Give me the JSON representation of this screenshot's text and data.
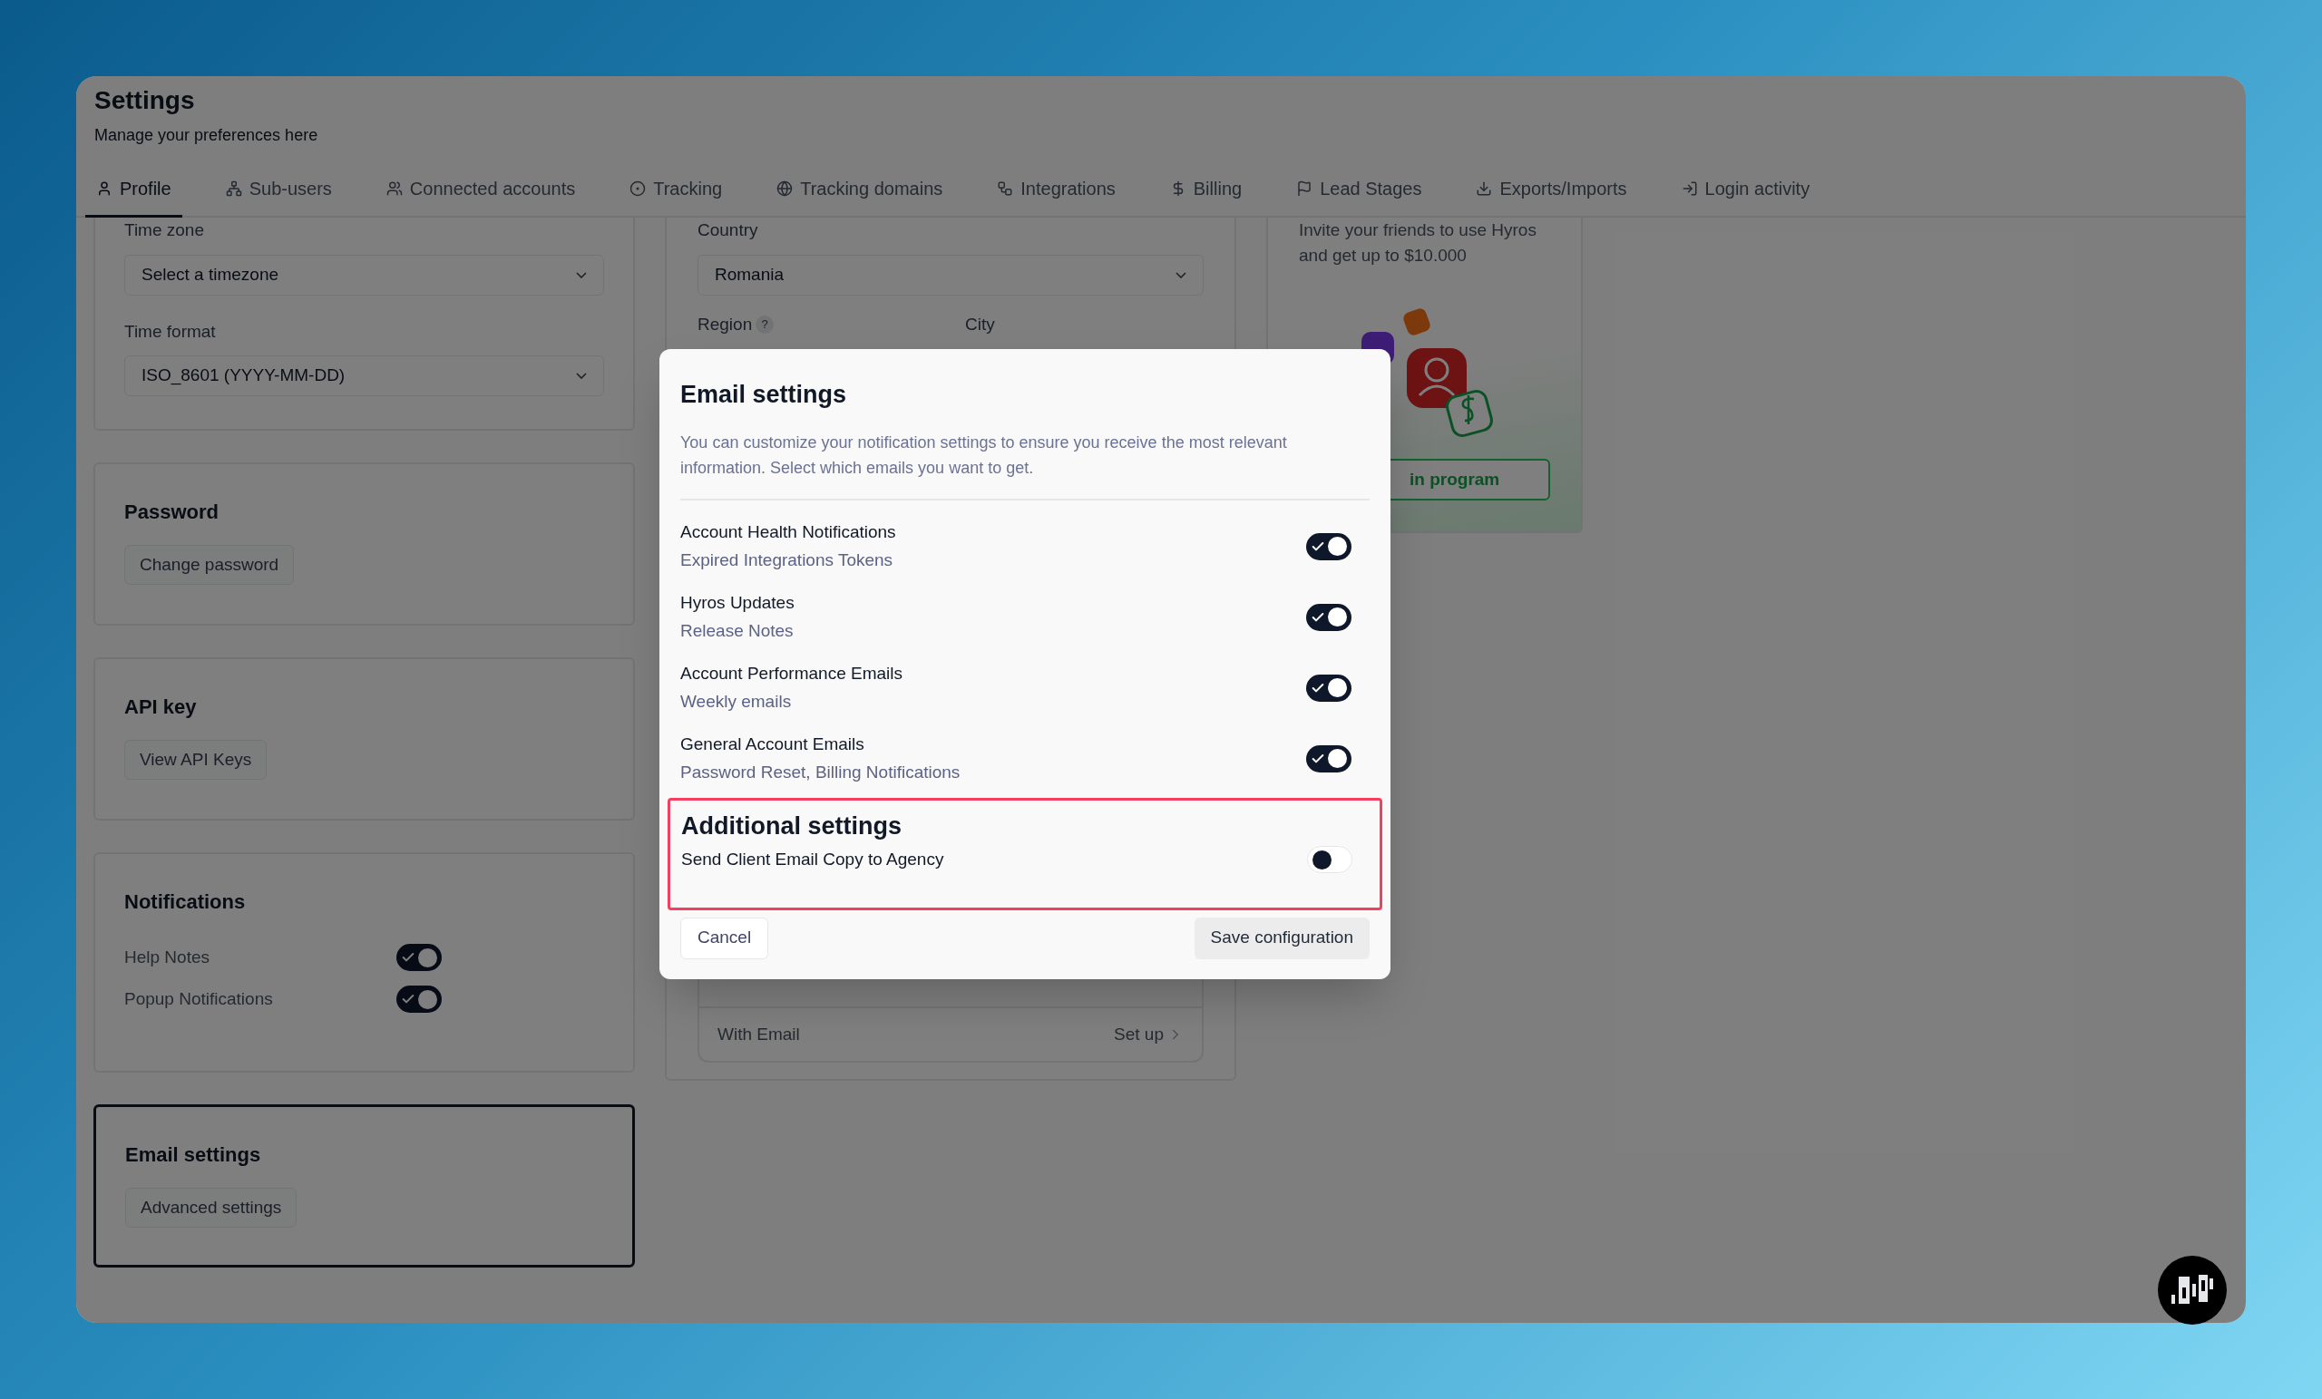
{
  "header": {
    "title": "Settings",
    "subtitle": "Manage your preferences here"
  },
  "tabs": [
    {
      "label": "Profile",
      "selected": true
    },
    {
      "label": "Sub-users",
      "selected": false
    },
    {
      "label": "Connected accounts",
      "selected": false
    },
    {
      "label": "Tracking",
      "selected": false
    },
    {
      "label": "Tracking domains",
      "selected": false
    },
    {
      "label": "Integrations",
      "selected": false
    },
    {
      "label": "Billing",
      "selected": false
    },
    {
      "label": "Lead Stages",
      "selected": false
    },
    {
      "label": "Exports/Imports",
      "selected": false
    },
    {
      "label": "Login activity",
      "selected": false
    }
  ],
  "left_column": {
    "time_zone": {
      "label": "Time zone",
      "value": "Select a timezone"
    },
    "time_format": {
      "label": "Time format",
      "value": "ISO_8601 (YYYY-MM-DD)"
    },
    "cards": [
      {
        "title": "Password",
        "button": "Change password",
        "active": false
      },
      {
        "title": "API key",
        "button": "View API Keys",
        "active": false
      }
    ],
    "notifications": {
      "title": "Notifications",
      "items": [
        {
          "label": "Help Notes",
          "on": true
        },
        {
          "label": "Popup Notifications",
          "on": true
        }
      ]
    },
    "email_settings": {
      "title": "Email settings",
      "button": "Advanced settings",
      "active": true
    }
  },
  "middle_column": {
    "country": {
      "label": "Country",
      "value": "Romania"
    },
    "region": {
      "label": "Region",
      "help": "?"
    },
    "city": {
      "label": "City"
    },
    "two_factor_rows": [
      {
        "label": "With Email",
        "action": "Set up"
      }
    ]
  },
  "referral": {
    "text": "Invite your friends to use Hyros and get up to $10.000",
    "button": "in program"
  },
  "modal": {
    "title": "Email settings",
    "description": "You can customize your notification settings to ensure you receive the most relevant information. Select which emails you want to get.",
    "items": [
      {
        "title": "Account Health Notifications",
        "subtitle": "Expired Integrations Tokens",
        "on": true
      },
      {
        "title": "Hyros Updates",
        "subtitle": "Release Notes",
        "on": true
      },
      {
        "title": "Account Performance Emails",
        "subtitle": "Weekly emails",
        "on": true
      },
      {
        "title": "General Account Emails",
        "subtitle": "Password Reset, Billing Notifications",
        "on": true
      }
    ],
    "additional": {
      "title": "Additional settings",
      "highlighted": true,
      "items": [
        {
          "label": "Send Client Email Copy to Agency",
          "on": false
        }
      ]
    },
    "cancel": "Cancel",
    "save": "Save configuration"
  }
}
